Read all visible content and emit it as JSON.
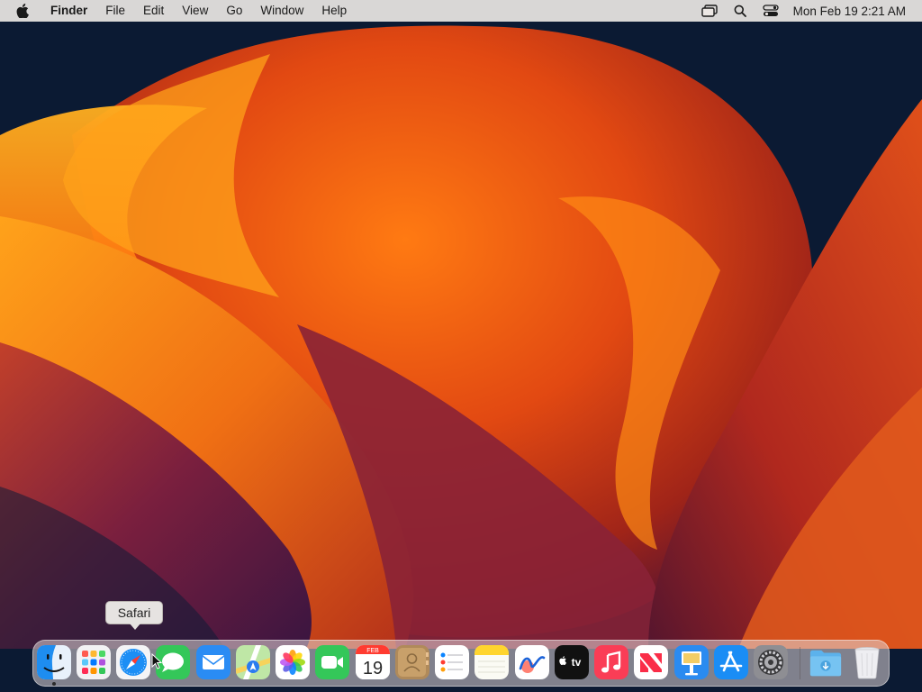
{
  "menubar": {
    "apple_icon": "apple-logo-icon",
    "app_name": "Finder",
    "menus": [
      "File",
      "Edit",
      "View",
      "Go",
      "Window",
      "Help"
    ],
    "status_icons": [
      "screen-mirroring-icon",
      "search-icon",
      "control-center-icon"
    ],
    "clock": "Mon Feb 19  2:21 AM"
  },
  "tooltip": {
    "text": "Safari"
  },
  "dock": {
    "apps": [
      {
        "name": "Finder",
        "icon": "finder-icon",
        "running": true
      },
      {
        "name": "Launchpad",
        "icon": "launchpad-icon"
      },
      {
        "name": "Safari",
        "icon": "safari-icon"
      },
      {
        "name": "Messages",
        "icon": "messages-icon"
      },
      {
        "name": "Mail",
        "icon": "mail-icon"
      },
      {
        "name": "Maps",
        "icon": "maps-icon"
      },
      {
        "name": "Photos",
        "icon": "photos-icon"
      },
      {
        "name": "FaceTime",
        "icon": "facetime-icon"
      },
      {
        "name": "Calendar",
        "icon": "calendar-icon",
        "month": "FEB",
        "day": "19"
      },
      {
        "name": "Contacts",
        "icon": "contacts-icon"
      },
      {
        "name": "Reminders",
        "icon": "reminders-icon"
      },
      {
        "name": "Notes",
        "icon": "notes-icon"
      },
      {
        "name": "Freeform",
        "icon": "freeform-icon"
      },
      {
        "name": "TV",
        "icon": "apple-tv-icon",
        "label": "tv"
      },
      {
        "name": "Music",
        "icon": "music-icon"
      },
      {
        "name": "News",
        "icon": "news-icon"
      },
      {
        "name": "Keynote",
        "icon": "keynote-icon"
      },
      {
        "name": "App Store",
        "icon": "app-store-icon"
      },
      {
        "name": "System Settings",
        "icon": "system-settings-icon"
      }
    ],
    "extras": [
      {
        "name": "Downloads",
        "icon": "downloads-folder-icon"
      },
      {
        "name": "Trash",
        "icon": "trash-icon"
      }
    ]
  },
  "colors": {
    "accent_orange": "#ff7a12",
    "menubar_bg": "#ece7e4",
    "desktop_navy": "#0b1a33"
  }
}
